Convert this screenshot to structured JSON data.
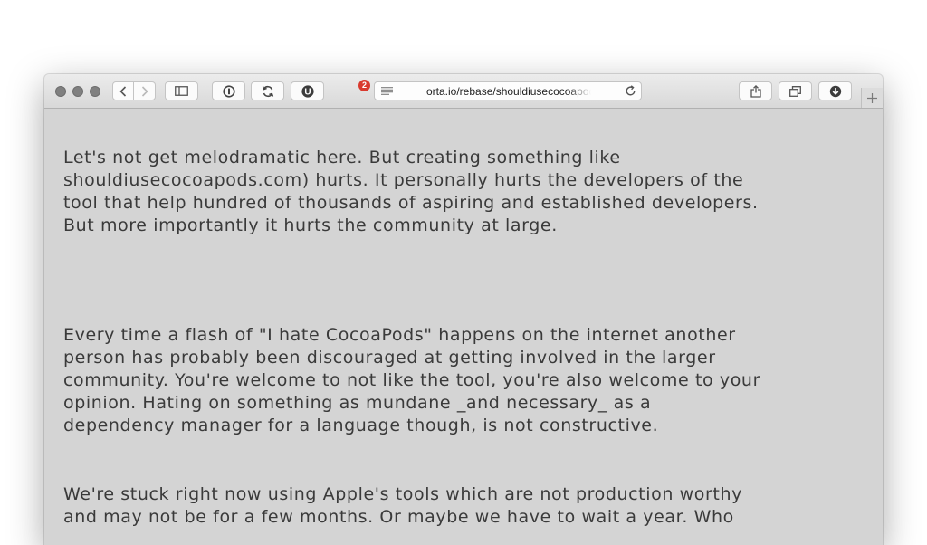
{
  "browser": {
    "address_url": "orta.io/rebase/shouldiusecocoapods",
    "extension_badge_count": "2",
    "extension_label": "U"
  },
  "article": {
    "paragraphs": [
      "Let's not get melodramatic here. But creating something like\nshouldiusecocoapods.com) hurts. It personally hurts the developers of the\ntool that help hundred of thousands of aspiring and established developers.\nBut more importantly it hurts the community at large.",
      "Every time a flash of \"I hate CocoaPods\" happens on the internet another\nperson has probably been discouraged at getting involved in the larger\ncommunity. You're welcome to not like the tool, you're also welcome to your\nopinion. Hating on something as mundane _and necessary_ as a\ndependency manager for a language though, is not constructive.",
      "We're stuck right now using Apple's tools which are not production worthy\nand may not be for a few months. Or maybe we have to wait a year. Who"
    ]
  },
  "colors": {
    "page_background": "#d4d4d4",
    "text": "#3a3a3a",
    "badge": "#d93a2e"
  }
}
